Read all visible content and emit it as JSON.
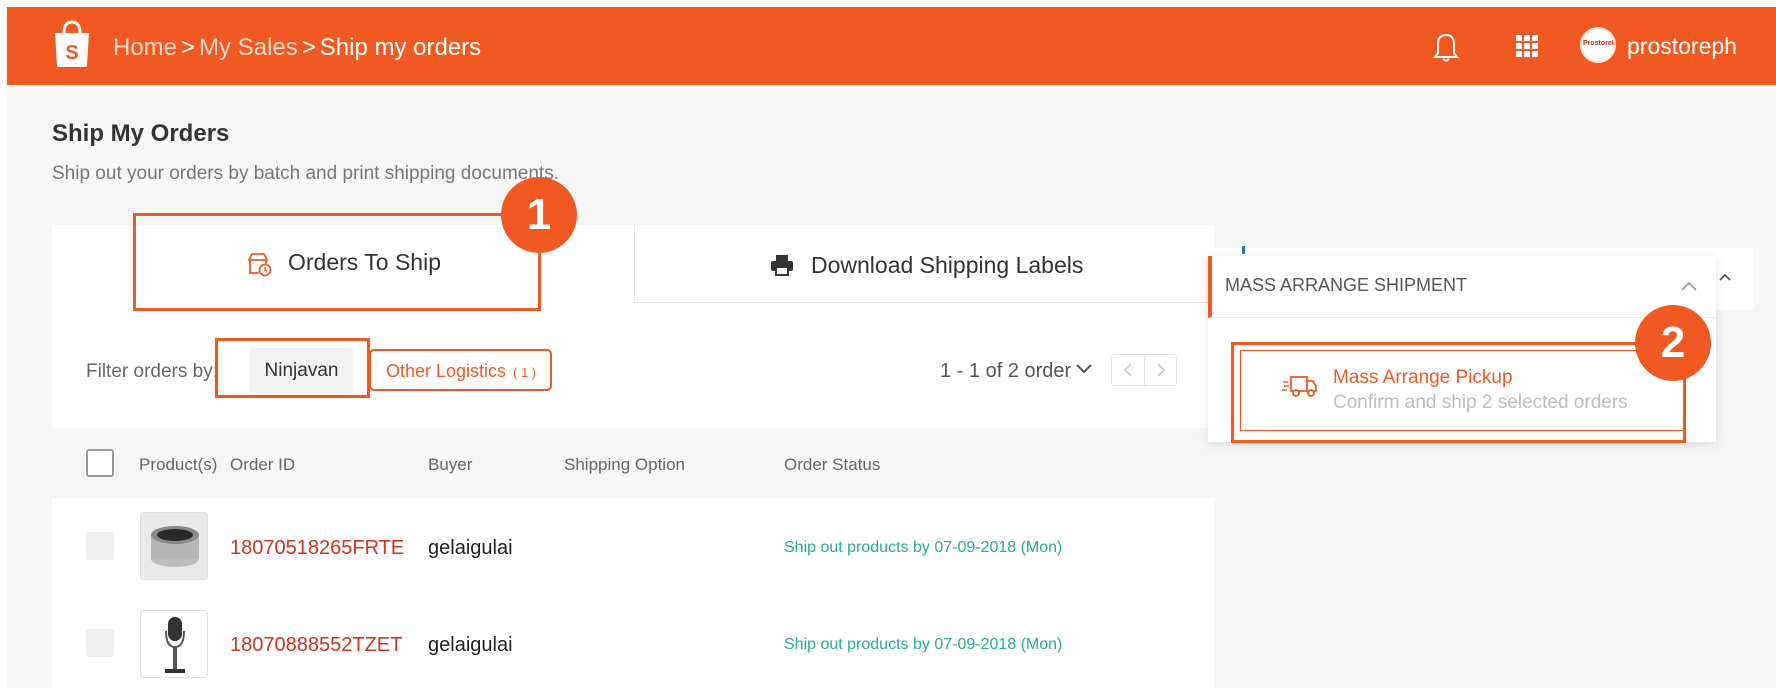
{
  "header": {
    "breadcrumb": {
      "home": "Home",
      "sales": "My Sales",
      "current": "Ship my orders",
      "separator": ">"
    },
    "username": "prostoreph",
    "avatar_text": "ProstoreP"
  },
  "page": {
    "title": "Ship My Orders",
    "subtitle": "Ship out your orders by batch and print shipping documents."
  },
  "tabs": {
    "orders_to_ship": "Orders To Ship",
    "download_labels": "Download Shipping Labels"
  },
  "filter": {
    "label": "Filter orders by:",
    "ninjavan": "Ninjavan",
    "other_logistics": "Other Logistics",
    "other_logistics_count": "( 1 )"
  },
  "pagination": {
    "text": "1 - 1 of 2 order"
  },
  "table": {
    "columns": {
      "products": "Product(s)",
      "order_id": "Order ID",
      "buyer": "Buyer",
      "shipping_option": "Shipping Option",
      "order_status": "Order Status"
    },
    "rows": [
      {
        "order_id": "18070518265FRTE",
        "buyer": "gelaigulai",
        "status": "Ship out products by 07-09-2018 (Mon)"
      },
      {
        "order_id": "18070888552TZET",
        "buyer": "gelaigulai",
        "status": "Ship out products by 07-09-2018 (Mon)"
      }
    ]
  },
  "mass_shipment": {
    "title": "MASS ARRANGE SHIPMENT",
    "pickup_label": "Mass Arrange Pickup",
    "pickup_sub": "Confirm and ship 2 selected orders"
  },
  "annotations": {
    "step1": "1",
    "step2": "2"
  },
  "colors": {
    "brand": "#f05a22",
    "order_id": "#d0341b",
    "status": "#26aa99"
  }
}
